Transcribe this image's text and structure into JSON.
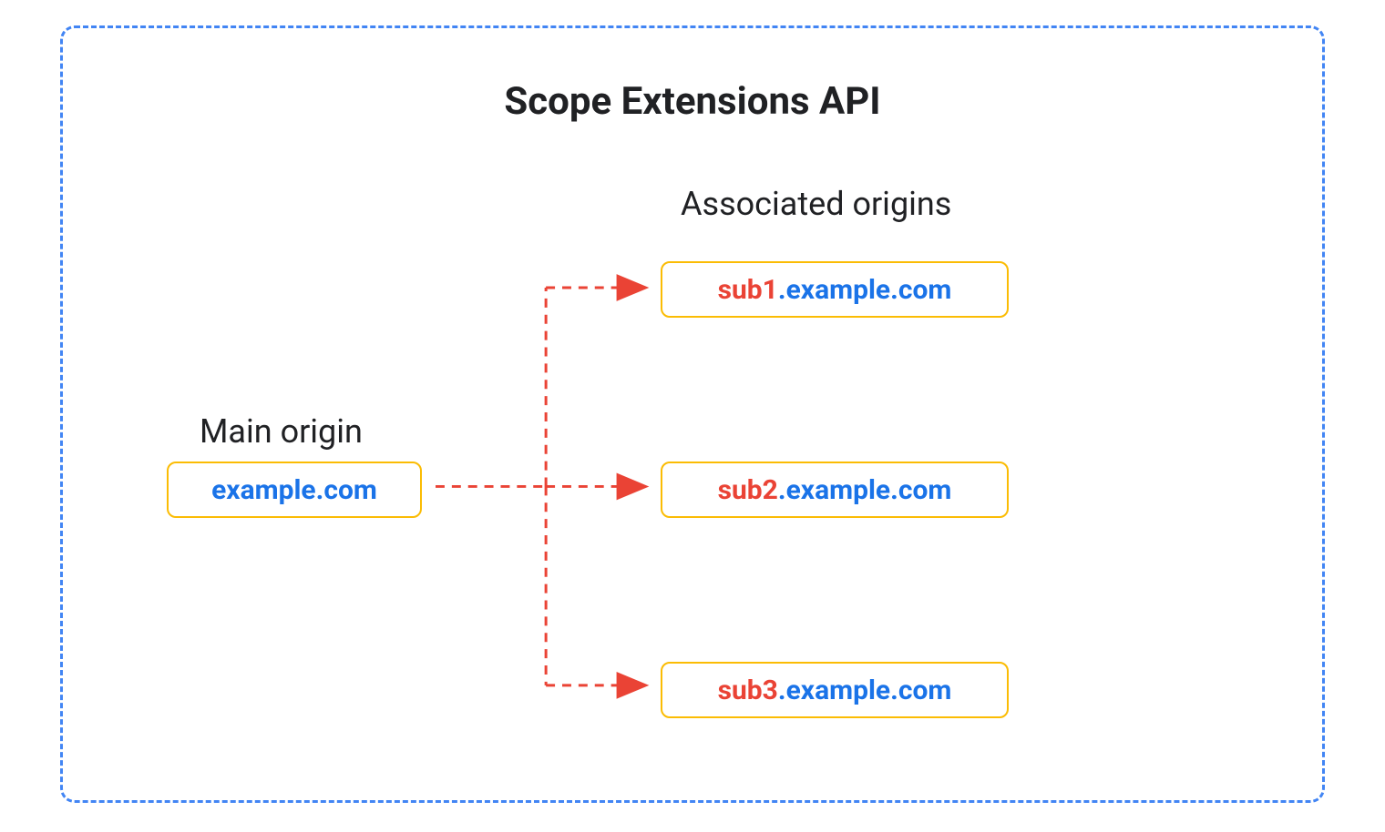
{
  "title": "Scope Extensions API",
  "main_origin": {
    "label": "Main origin",
    "domain": "example.com"
  },
  "associated": {
    "label": "Associated origins",
    "items": [
      {
        "prefix": "sub1",
        "suffix": ".example.com"
      },
      {
        "prefix": "sub2",
        "suffix": ".example.com"
      },
      {
        "prefix": "sub3",
        "suffix": ".example.com"
      }
    ]
  },
  "colors": {
    "border_blue": "#4285f4",
    "box_orange": "#fbbc04",
    "text_blue": "#1a73e8",
    "text_red": "#ea4335",
    "text_dark": "#202124"
  }
}
